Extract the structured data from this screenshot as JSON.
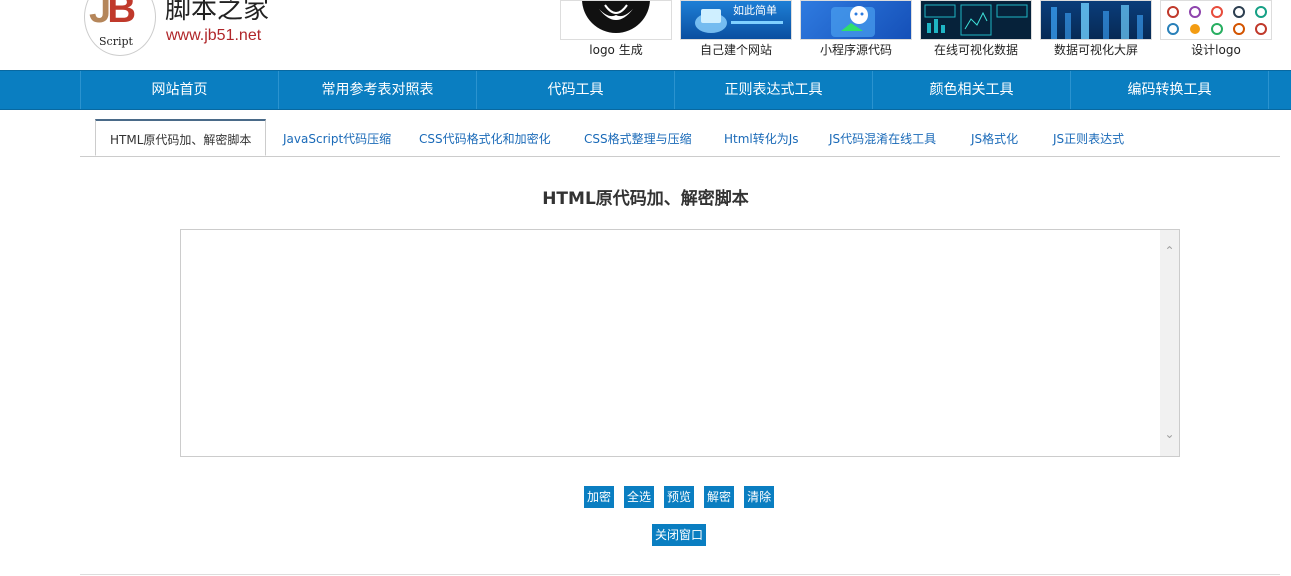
{
  "site": {
    "name": "脚本之家",
    "url": "www.jb51.net",
    "logo_letters": "JB",
    "logo_script": "Script"
  },
  "ads": [
    {
      "caption": "logo 生成",
      "icon": "lotus-logo-icon"
    },
    {
      "caption": "自己建个网站",
      "icon": "website-builder-icon",
      "banner_text": "如此简单"
    },
    {
      "caption": "小程序源代码",
      "icon": "wechat-miniprogram-icon"
    },
    {
      "caption": "在线可视化数据",
      "icon": "dashboard-icon"
    },
    {
      "caption": "数据可视化大屏",
      "icon": "big-screen-icon"
    },
    {
      "caption": "设计logo",
      "icon": "logo-grid-icon"
    }
  ],
  "nav": [
    "网站首页",
    "常用参考表对照表",
    "代码工具",
    "正则表达式工具",
    "颜色相关工具",
    "编码转换工具"
  ],
  "tabs": [
    "HTML原代码加、解密脚本",
    "JavaScript代码压缩",
    "CSS代码格式化和加密化",
    "CSS格式整理与压缩",
    "Html转化为Js",
    "JS代码混淆在线工具",
    "JS格式化",
    "JS正则表达式"
  ],
  "main": {
    "title": "HTML原代码加、解密脚本",
    "textarea_value": "",
    "buttons": [
      "加密",
      "全选",
      "预览",
      "解密",
      "清除"
    ],
    "close_button": "关闭窗口"
  },
  "colors": {
    "brand_blue": "#0a7ec1",
    "link_blue": "#1a6ab8",
    "url_red": "#b0262a"
  }
}
